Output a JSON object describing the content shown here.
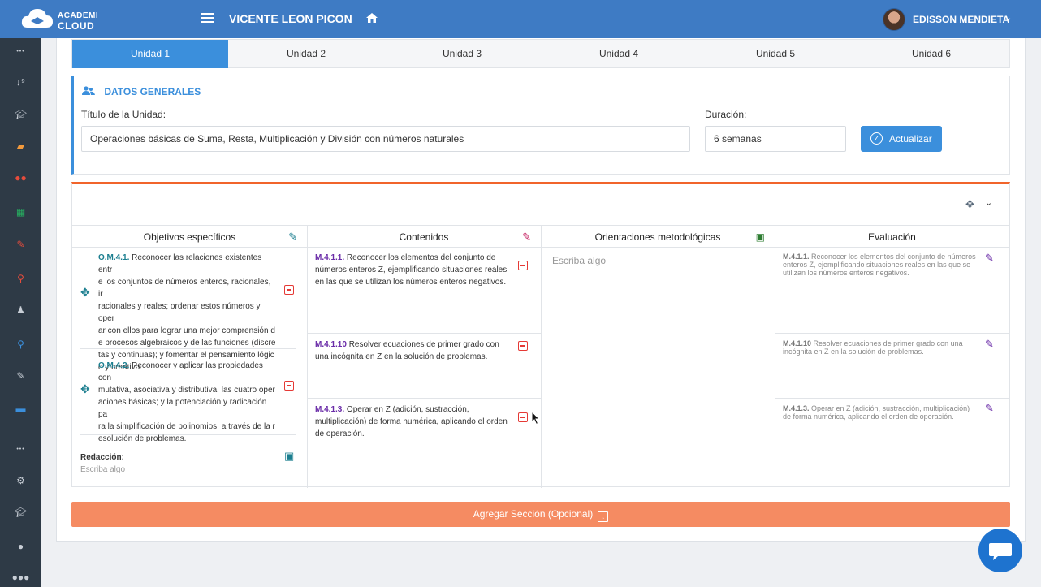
{
  "header": {
    "logo_line1": "ACADEMI",
    "logo_line2": "CLOUD",
    "student_name": "VICENTE LEON PICON",
    "user_name": "EDISSON MENDIETA",
    "user_caret": "⌄"
  },
  "sidebar": {
    "items": [
      {
        "icon": "more-dots-icon",
        "glyph": "•••",
        "color": "#c8ced6"
      },
      {
        "icon": "sort-icon",
        "glyph": "↓⁹",
        "color": "#c8ced6"
      },
      {
        "icon": "graduation-cap-icon",
        "glyph": "🎓︎",
        "color": "#c8ced6"
      },
      {
        "icon": "folder-open-icon",
        "glyph": "▰",
        "color": "#f39a3c"
      },
      {
        "icon": "users-icon",
        "glyph": "●●",
        "color": "#e74c3c"
      },
      {
        "icon": "calendar-icon",
        "glyph": "▦",
        "color": "#27ae60"
      },
      {
        "icon": "edit-icon",
        "glyph": "✎",
        "color": "#e74c3c"
      },
      {
        "icon": "search-icon",
        "glyph": "⚲",
        "color": "#e74c3c"
      },
      {
        "icon": "user-tie-icon",
        "glyph": "♟",
        "color": "#c8ced6"
      },
      {
        "icon": "search-blue-icon",
        "glyph": "⚲",
        "color": "#3b8fdc"
      },
      {
        "icon": "edit-white-icon",
        "glyph": "✎",
        "color": "#c8ced6"
      },
      {
        "icon": "briefcase-icon",
        "glyph": "▬",
        "color": "#3b8fdc"
      },
      {
        "icon": "more-dots-icon",
        "glyph": "•••",
        "color": "#c8ced6"
      },
      {
        "icon": "cogs-icon",
        "glyph": "⚙",
        "color": "#c8ced6"
      },
      {
        "icon": "graduation-cap-icon",
        "glyph": "🎓︎",
        "color": "#c8ced6"
      },
      {
        "icon": "user-icon",
        "glyph": "●",
        "color": "#c8ced6"
      },
      {
        "icon": "users-group-icon",
        "glyph": "●●●",
        "color": "#c8ced6"
      }
    ]
  },
  "tabs": [
    "Unidad 1",
    "Unidad 2",
    "Unidad 3",
    "Unidad 4",
    "Unidad 5",
    "Unidad 6"
  ],
  "datos": {
    "title": "DATOS GENERALES",
    "titulo_label": "Título de la Unidad:",
    "titulo_value": "Operaciones básicas de Suma, Resta, Multiplicación y División con números naturales",
    "duracion_label": "Duración:",
    "duracion_value": "6 semanas",
    "actualizar_label": "Actualizar"
  },
  "table": {
    "headers": [
      "Objetivos específicos",
      "Contenidos",
      "Orientaciones metodológicas",
      "Evaluación"
    ],
    "objetivos": [
      {
        "code": "O.M.4.1.",
        "lines": [
          " Reconocer las relaciones existentes entr",
          "e los conjuntos de números enteros, racionales, ir",
          "racionales y reales; ordenar estos números y oper",
          "ar con ellos para lograr una mejor comprensión d",
          "e procesos algebraicos y de las funciones (discre",
          "tas y continuas); y fomentar el pensamiento lógic",
          "o y creativo."
        ]
      },
      {
        "code": "O.M.4.2.",
        "lines": [
          " Reconocer y aplicar las propiedades con",
          "mutativa, asociativa y distributiva; las cuatro oper",
          "aciones básicas; y la potenciación y radicación pa",
          "ra la simplificación de polinomios, a través de la r",
          "esolución de problemas."
        ]
      }
    ],
    "redaccion_label": "Redacción:",
    "redaccion_placeholder": "Escriba algo",
    "contenidos": [
      {
        "code": "M.4.1.1.",
        "lines": [
          " Reconocer los elementos del conjunto de",
          "números enteros Z, ejemplificando situaciones reales",
          "en las que se utilizan los números enteros negativos."
        ]
      },
      {
        "code": "M.4.1.10",
        "lines": [
          " Resolver ecuaciones de primer grado con",
          "una incógnita en Z en la solución de problemas."
        ]
      },
      {
        "code": "M.4.1.3.",
        "lines": [
          " Operar en Z (adición, sustracción,",
          "multiplicación) de forma numérica, aplicando el orden",
          "de operación."
        ]
      }
    ],
    "orientaciones_placeholder": "Escriba algo",
    "evaluacion": [
      {
        "code": "M.4.1.1.",
        "lines": [
          " Reconocer los elementos del conjunto de números",
          "enteros Z, ejemplificando situaciones reales en las que se",
          "utilizan los números enteros negativos."
        ]
      },
      {
        "code": "M.4.1.10",
        "lines": [
          " Resolver ecuaciones de primer grado con una",
          "incógnita en Z en la solución de problemas."
        ]
      },
      {
        "code": "M.4.1.3.",
        "lines": [
          " Operar en Z (adición, sustracción, multiplicación)",
          "de forma numérica, aplicando el orden de operación."
        ]
      }
    ]
  },
  "agregar_label": "Agregar Sección (Opcional)"
}
